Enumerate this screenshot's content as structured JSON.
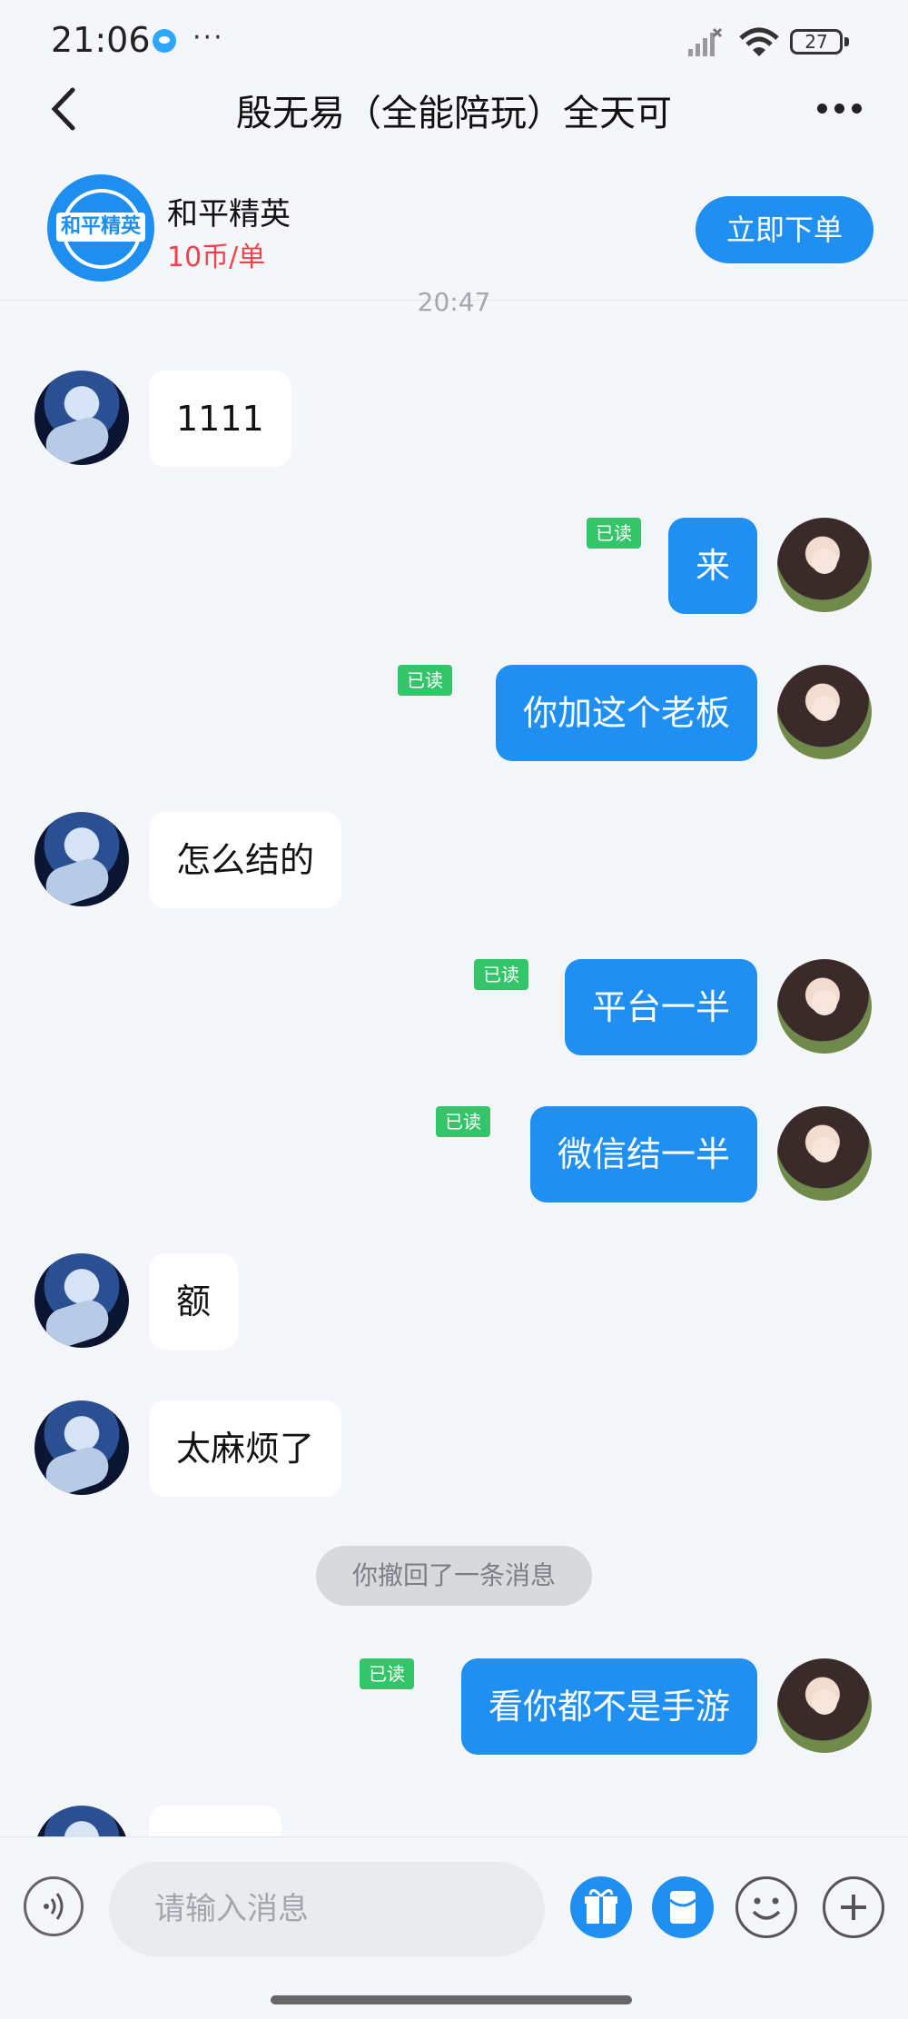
{
  "status_bar": {
    "time": "21:06",
    "dots": "···",
    "battery": "27"
  },
  "header": {
    "title": "殷无易（全能陪玩）全天可"
  },
  "service": {
    "logo_text": "和平精英",
    "game_name": "和平精英",
    "price": "10币/单",
    "order_label": "立即下单"
  },
  "chat": {
    "timestamp": "20:47",
    "read_label": "已读",
    "recall_notice": "你撤回了一条消息",
    "messages": [
      {
        "from": "other",
        "text": "1111"
      },
      {
        "from": "self",
        "text": "来",
        "read": true
      },
      {
        "from": "self",
        "text": "你加这个老板",
        "read": true
      },
      {
        "from": "other",
        "text": "怎么结的"
      },
      {
        "from": "self",
        "text": "平台一半",
        "read": true
      },
      {
        "from": "self",
        "text": "微信结一半",
        "read": true
      },
      {
        "from": "other",
        "text": "额"
      },
      {
        "from": "other",
        "text": "太麻烦了"
      },
      {
        "from": "self",
        "text": "看你都不是手游",
        "read": true
      }
    ]
  },
  "input": {
    "placeholder": "请输入消息"
  },
  "colors": {
    "accent": "#1f8ff2",
    "read_badge": "#34c46a",
    "price": "#f0424a",
    "background": "#f4f6fa"
  }
}
